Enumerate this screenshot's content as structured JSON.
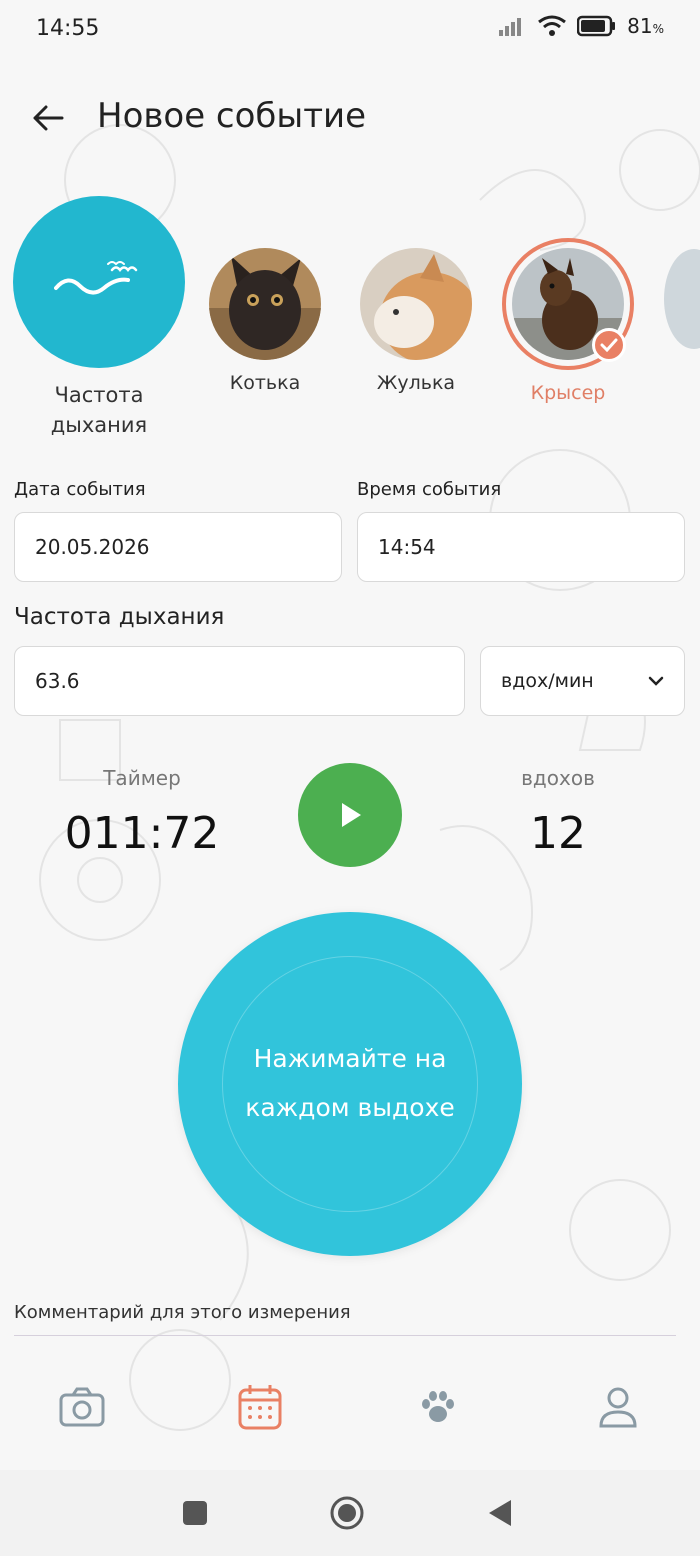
{
  "status_bar": {
    "time": "14:55",
    "battery_percent": "81",
    "battery_unit": "%"
  },
  "header": {
    "title": "Новое событие"
  },
  "event_type": {
    "label_line1": "Частота",
    "label_line2": "дыхания",
    "color": "#22b7cf"
  },
  "pets": [
    {
      "name": "Котька",
      "selected": false
    },
    {
      "name": "Жулька",
      "selected": false
    },
    {
      "name": "Крысер",
      "selected": true
    }
  ],
  "date_field": {
    "label": "Дата события",
    "value": "20.05.2026"
  },
  "time_field": {
    "label": "Время события",
    "value": "14:54"
  },
  "rate": {
    "title": "Частота дыхания",
    "value": "63.6",
    "unit": "вдох/мин"
  },
  "timer": {
    "label": "Таймер",
    "value": "011:72"
  },
  "breaths": {
    "label": "вдохов",
    "value": "12"
  },
  "tap_button": {
    "line1": "Нажимайте на",
    "line2": "каждом выдохе"
  },
  "comment": {
    "label": "Комментарий для этого измерения"
  },
  "bottom_nav": [
    "camera-icon",
    "calendar-icon",
    "paw-icon",
    "profile-icon"
  ],
  "colors": {
    "accent": "#e98064",
    "primary": "#31c4db",
    "play": "#4caf50"
  }
}
